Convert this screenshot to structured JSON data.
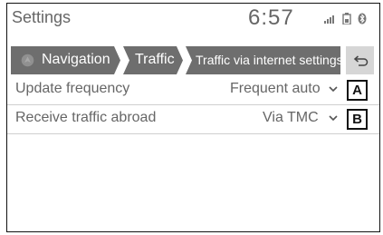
{
  "header": {
    "title": "Settings",
    "time": "6:57"
  },
  "status_icons": [
    "signal-icon",
    "battery-icon",
    "bluetooth-icon"
  ],
  "breadcrumb": {
    "items": [
      {
        "label": "Navigation",
        "icon": "navigation-icon"
      },
      {
        "label": "Traffic"
      },
      {
        "label": "Traffic via internet settings"
      }
    ],
    "back_icon": "back-arrow-icon"
  },
  "settings": [
    {
      "label": "Update frequency",
      "value": "Frequent auto",
      "callout": "A"
    },
    {
      "label": "Receive traffic abroad",
      "value": "Via TMC",
      "callout": "B"
    }
  ],
  "colors": {
    "breadcrumb_bg": "#6e6e6e",
    "back_button_bg": "#d6d6d6",
    "text": "#666666"
  }
}
